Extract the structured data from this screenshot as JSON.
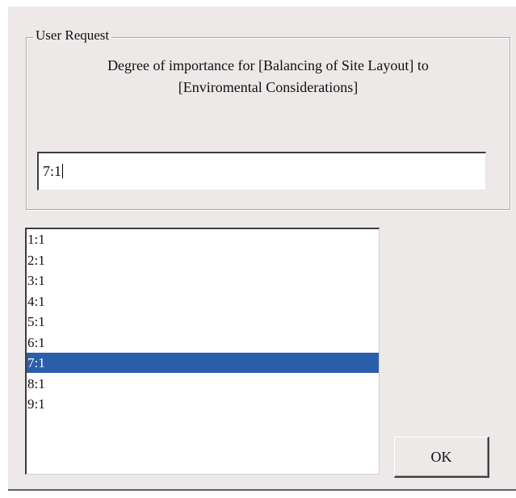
{
  "dialog": {
    "group_label": "User Request",
    "prompt_line1": "Degree of importance for [Balancing of Site Layout] to",
    "prompt_line2": "[Enviromental Considerations]",
    "input_value": "7:1",
    "ok_label": "OK",
    "selected_color": "#2a5ea8"
  },
  "list": {
    "items": [
      "1:1",
      "2:1",
      "3:1",
      "4:1",
      "5:1",
      "6:1",
      "7:1",
      "8:1",
      "9:1"
    ],
    "selected_index": 6
  }
}
